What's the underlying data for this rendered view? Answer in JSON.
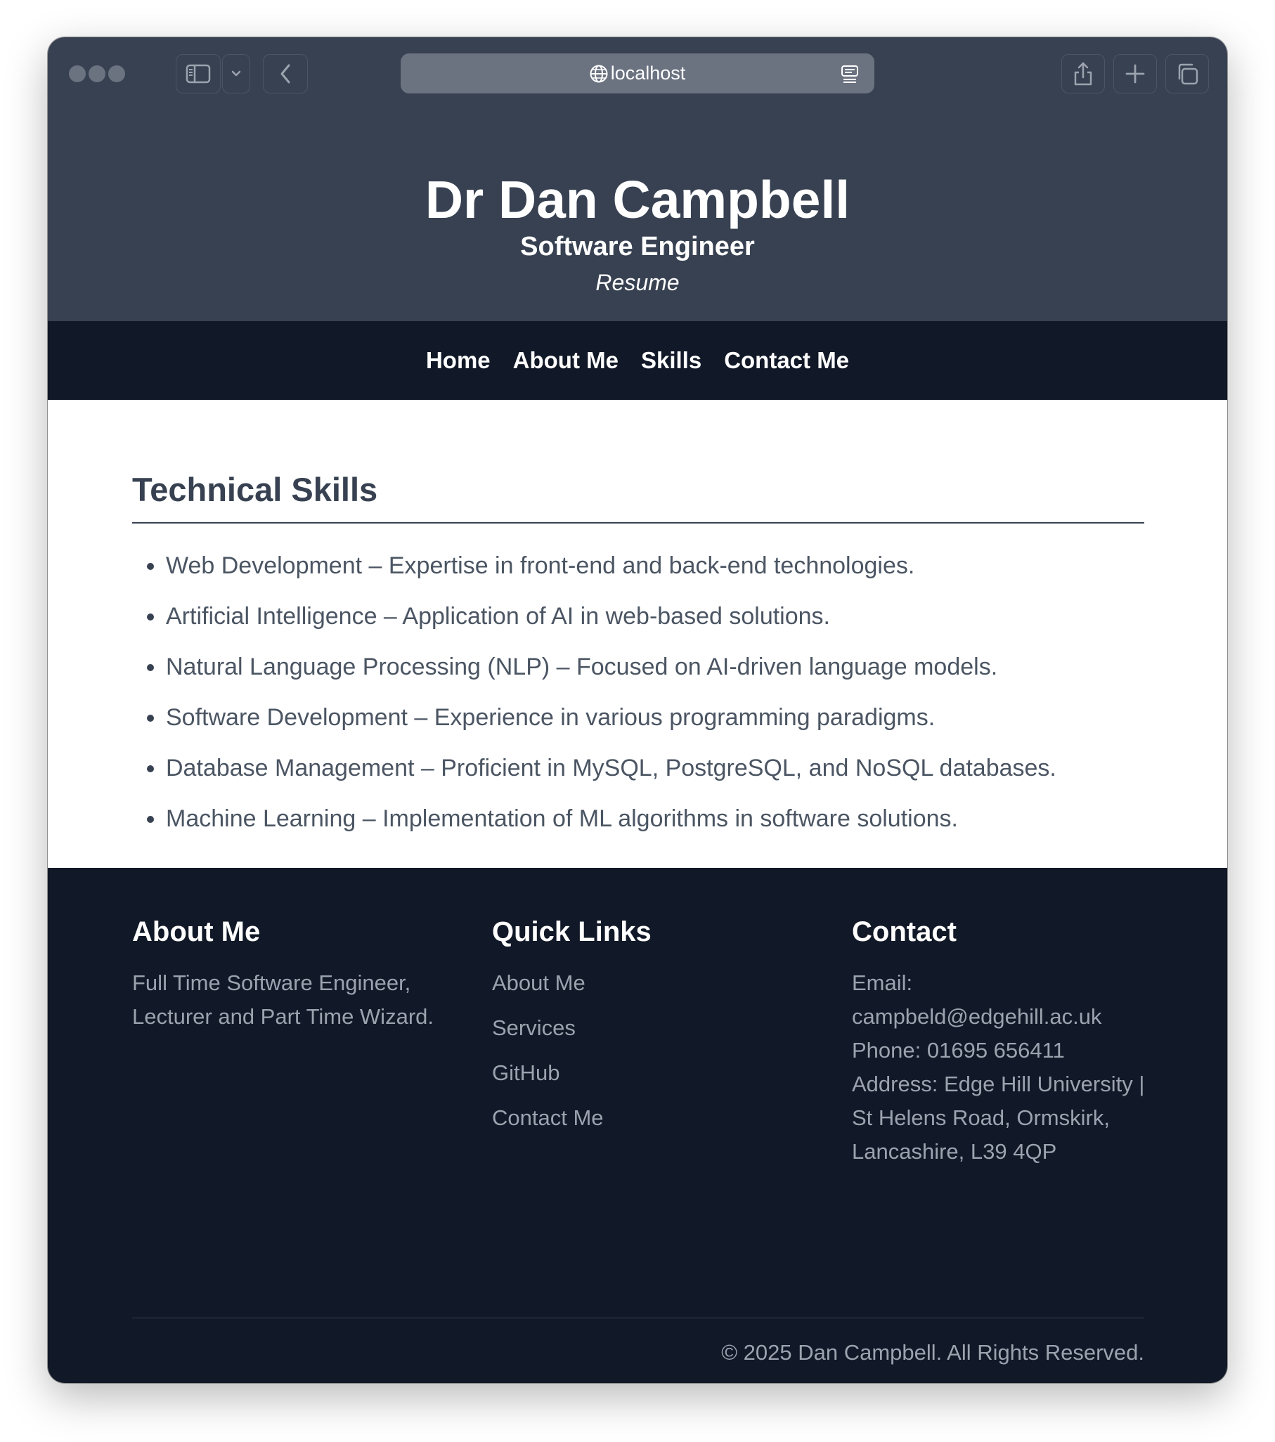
{
  "browser": {
    "url": "localhost"
  },
  "header": {
    "title": "Dr Dan Campbell",
    "subtitle": "Software Engineer",
    "tagline": "Resume"
  },
  "nav": {
    "items": [
      "Home",
      "About Me",
      "Skills",
      "Contact Me"
    ]
  },
  "main": {
    "section_title": "Technical Skills",
    "skills": [
      "Web Development – Expertise in front-end and back-end technologies.",
      "Artificial Intelligence – Application of AI in web-based solutions.",
      "Natural Language Processing (NLP) – Focused on AI-driven language models.",
      "Software Development – Experience in various programming paradigms.",
      "Database Management – Proficient in MySQL, PostgreSQL, and NoSQL databases.",
      "Machine Learning – Implementation of ML algorithms in software solutions."
    ]
  },
  "footer": {
    "about": {
      "heading": "About Me",
      "text": "Full Time Software Engineer, Lecturer and Part Time Wizard."
    },
    "links": {
      "heading": "Quick Links",
      "items": [
        "About Me",
        "Services",
        "GitHub",
        "Contact Me"
      ]
    },
    "contact": {
      "heading": "Contact",
      "email": "Email: campbeld@edgehill.ac.uk",
      "phone": "Phone: 01695 656411",
      "address": "Address: Edge Hill University | St Helens Road, Ormskirk, Lancashire, L39 4QP"
    },
    "copyright": "© 2025 Dan Campbell. All Rights Reserved."
  },
  "colors": {
    "header_bg": "#374151",
    "nav_bg": "#111827",
    "footer_bg": "#111827",
    "muted_text": "#9ca3af",
    "body_text": "#4b5563"
  }
}
